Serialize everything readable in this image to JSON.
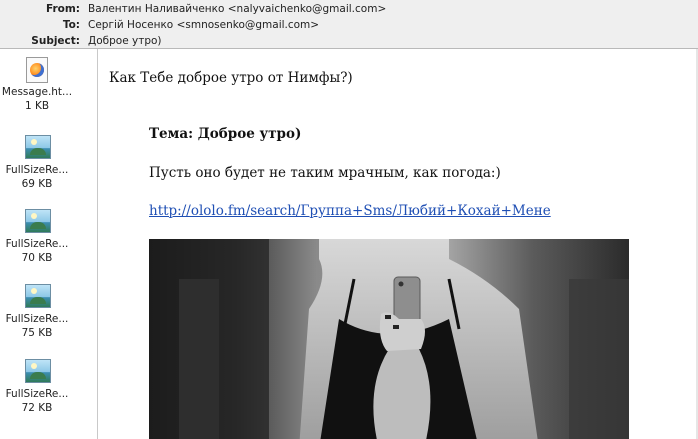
{
  "header": {
    "from_label": "From:",
    "from_value": "Валентин Наливайченко <nalyvaichenko@gmail.com>",
    "to_label": "To:",
    "to_value": "Сергій Носенко <smnosenko@gmail.com>",
    "subject_label": "Subject:",
    "subject_value": "Доброе утро)"
  },
  "attachments": [
    {
      "name": "Message.ht...",
      "size": "1 KB",
      "icon": "firefox-html-icon"
    },
    {
      "name": "FullSizeRe...",
      "size": "69 KB",
      "icon": "image-file-icon"
    },
    {
      "name": "FullSizeRe...",
      "size": "70 KB",
      "icon": "image-file-icon"
    },
    {
      "name": "FullSizeRe...",
      "size": "75 KB",
      "icon": "image-file-icon"
    },
    {
      "name": "FullSizeRe...",
      "size": "72 KB",
      "icon": "image-file-icon"
    }
  ],
  "body": {
    "greeting": "Как Тебе доброе утро от Нимфы?)",
    "topic": "Тема: Доброе утро)",
    "paragraph": "Пусть оно будет не таким мрачным, как погода:)",
    "link": "http://ololo.fm/search/Группа+Sms/Любий+Кохай+Мене"
  }
}
